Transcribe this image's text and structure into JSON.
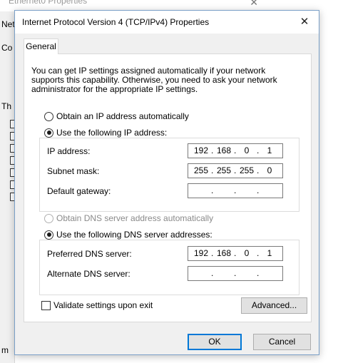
{
  "background_window": {
    "title": "Ethernet0 Properties",
    "close_glyph": "✕",
    "fragments": [
      "Netw",
      "Co",
      "Th",
      "m"
    ]
  },
  "dialog": {
    "title": "Internet Protocol Version 4 (TCP/IPv4) Properties",
    "close_glyph": "✕",
    "tab_general": "General",
    "description": "You can get IP settings assigned automatically if your network supports this capability. Otherwise, you need to ask your network administrator for the appropriate IP settings.",
    "ip_mode": {
      "auto_label": "Obtain an IP address automatically",
      "manual_label": "Use the following IP address:",
      "selected": "manual"
    },
    "ip_fields": {
      "ip_label": "IP address:",
      "ip_value": [
        "192",
        "168",
        "0",
        "1"
      ],
      "subnet_label": "Subnet mask:",
      "subnet_value": [
        "255",
        "255",
        "255",
        "0"
      ],
      "gateway_label": "Default gateway:",
      "gateway_value": [
        "",
        "",
        "",
        ""
      ]
    },
    "dns_mode": {
      "auto_label": "Obtain DNS server address automatically",
      "manual_label": "Use the following DNS server addresses:",
      "selected": "manual"
    },
    "dns_fields": {
      "preferred_label": "Preferred DNS server:",
      "preferred_value": [
        "192",
        "168",
        "0",
        "1"
      ],
      "alternate_label": "Alternate DNS server:",
      "alternate_value": [
        "",
        "",
        "",
        ""
      ]
    },
    "validate_label": "Validate settings upon exit",
    "validate_checked": false,
    "advanced_button": "Advanced...",
    "ok_button": "OK",
    "cancel_button": "Cancel",
    "ip_separator": "."
  },
  "colors": {
    "accent": "#0078d7",
    "dialog_bg": "#f0f0f0",
    "disabled_text": "#8a8a8a"
  }
}
